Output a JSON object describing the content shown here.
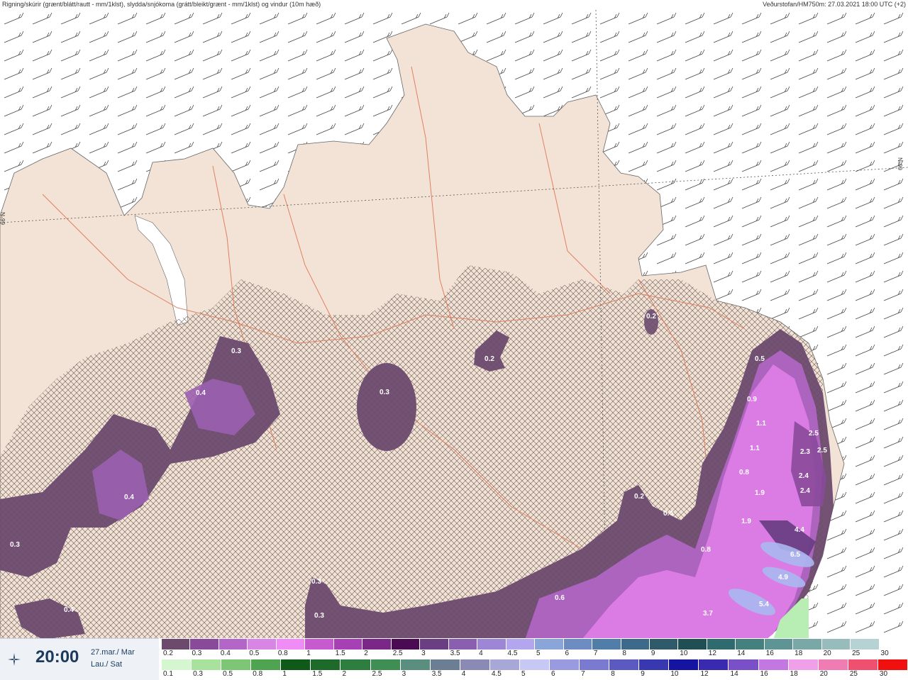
{
  "header": {
    "left": "Rigning/skúrir (grænt/blátt/rautt - mm/1klst), slydda/snjókoma (grátt/bleikt/grænt - mm/1klst) og vindur (10m hæð)",
    "right": "Veðurstofan/HM750m: 27.03.2021 18:00 UTC (+2)"
  },
  "map": {
    "lat_label": "66°N",
    "precip_labels": [
      {
        "v": "0.3"
      },
      {
        "v": "0.4"
      },
      {
        "v": "0.4"
      },
      {
        "v": "0.3"
      },
      {
        "v": "0.4"
      },
      {
        "v": "0.3"
      },
      {
        "v": "0.2"
      },
      {
        "v": "0.2"
      },
      {
        "v": "0.5"
      },
      {
        "v": "0.9"
      },
      {
        "v": "1.1"
      },
      {
        "v": "1.1"
      },
      {
        "v": "2.5"
      },
      {
        "v": "2.3"
      },
      {
        "v": "2.5"
      },
      {
        "v": "0.8"
      },
      {
        "v": "2.4"
      },
      {
        "v": "2.4"
      },
      {
        "v": "1.9"
      },
      {
        "v": "0.2"
      },
      {
        "v": "0.4"
      },
      {
        "v": "1.9"
      },
      {
        "v": "4.4"
      },
      {
        "v": "0.8"
      },
      {
        "v": "6.5"
      },
      {
        "v": "4.9"
      },
      {
        "v": "0.3"
      },
      {
        "v": "0.3"
      },
      {
        "v": "0.6"
      },
      {
        "v": "5.4"
      },
      {
        "v": "3.7"
      },
      {
        "v": "0.4"
      },
      {
        "v": "0.3"
      }
    ],
    "colors": {
      "land": "#f2e3d6",
      "sea": "#ffffff",
      "road": "#e08060",
      "snow_dark": "#6b4a72",
      "snow_mid": "#9b5fb0",
      "snow_pink": "#e07ee8",
      "snow_blue": "#a9b8f0",
      "rain_green": "#b8eeb4"
    }
  },
  "footer": {
    "time": "20:00",
    "date": "27.mar./ Mar",
    "day": "Lau./ Sat",
    "logo_icon": "vedur-logo-icon",
    "snow_scale": {
      "labels": [
        "0.2",
        "0.3",
        "0.4",
        "0.5",
        "0.8",
        "1",
        "1.5",
        "2",
        "2.5",
        "3",
        "3.5",
        "4",
        "4.5",
        "5",
        "6",
        "7",
        "8",
        "9",
        "10",
        "12",
        "14",
        "16",
        "18",
        "20",
        "25",
        "30"
      ],
      "colors": [
        "#6b4a6e",
        "#8a4a9a",
        "#b366c8",
        "#d985e6",
        "#f08cf5",
        "#c85ad0",
        "#a640b4",
        "#7a2788",
        "#4a0b52",
        "#6b3e84",
        "#8a5fb0",
        "#9e86d6",
        "#b3a6ee",
        "#8aa6d8",
        "#6d8dc2",
        "#517ea8",
        "#3d6a8a",
        "#2f5a6a",
        "#1f4f52",
        "#2e6a6e",
        "#44807e",
        "#5e9494",
        "#7aa8a6",
        "#98bcbc",
        "#b7d2d2",
        "#ffffff"
      ]
    },
    "rain_scale": {
      "labels": [
        "0.1",
        "0.3",
        "0.5",
        "0.8",
        "1",
        "1.5",
        "2",
        "2.5",
        "3",
        "3.5",
        "4",
        "4.5",
        "5",
        "6",
        "7",
        "8",
        "9",
        "10",
        "12",
        "14",
        "16",
        "18",
        "20",
        "25",
        "30"
      ],
      "colors": [
        "#d4f7cf",
        "#a8e29c",
        "#7cc676",
        "#4ea450",
        "#0f5a18",
        "#1d6a2a",
        "#2e7e40",
        "#3f8e54",
        "#5a8e7e",
        "#6c7e94",
        "#8a8ab4",
        "#a8a8d8",
        "#c8c8f4",
        "#9a9ae0",
        "#7a7ad0",
        "#5a5ac0",
        "#3838b0",
        "#1414a0",
        "#3a2ab0",
        "#7a50c8",
        "#c278e0",
        "#f0a0e8",
        "#f07cb4",
        "#f05070",
        "#f01010"
      ]
    }
  }
}
